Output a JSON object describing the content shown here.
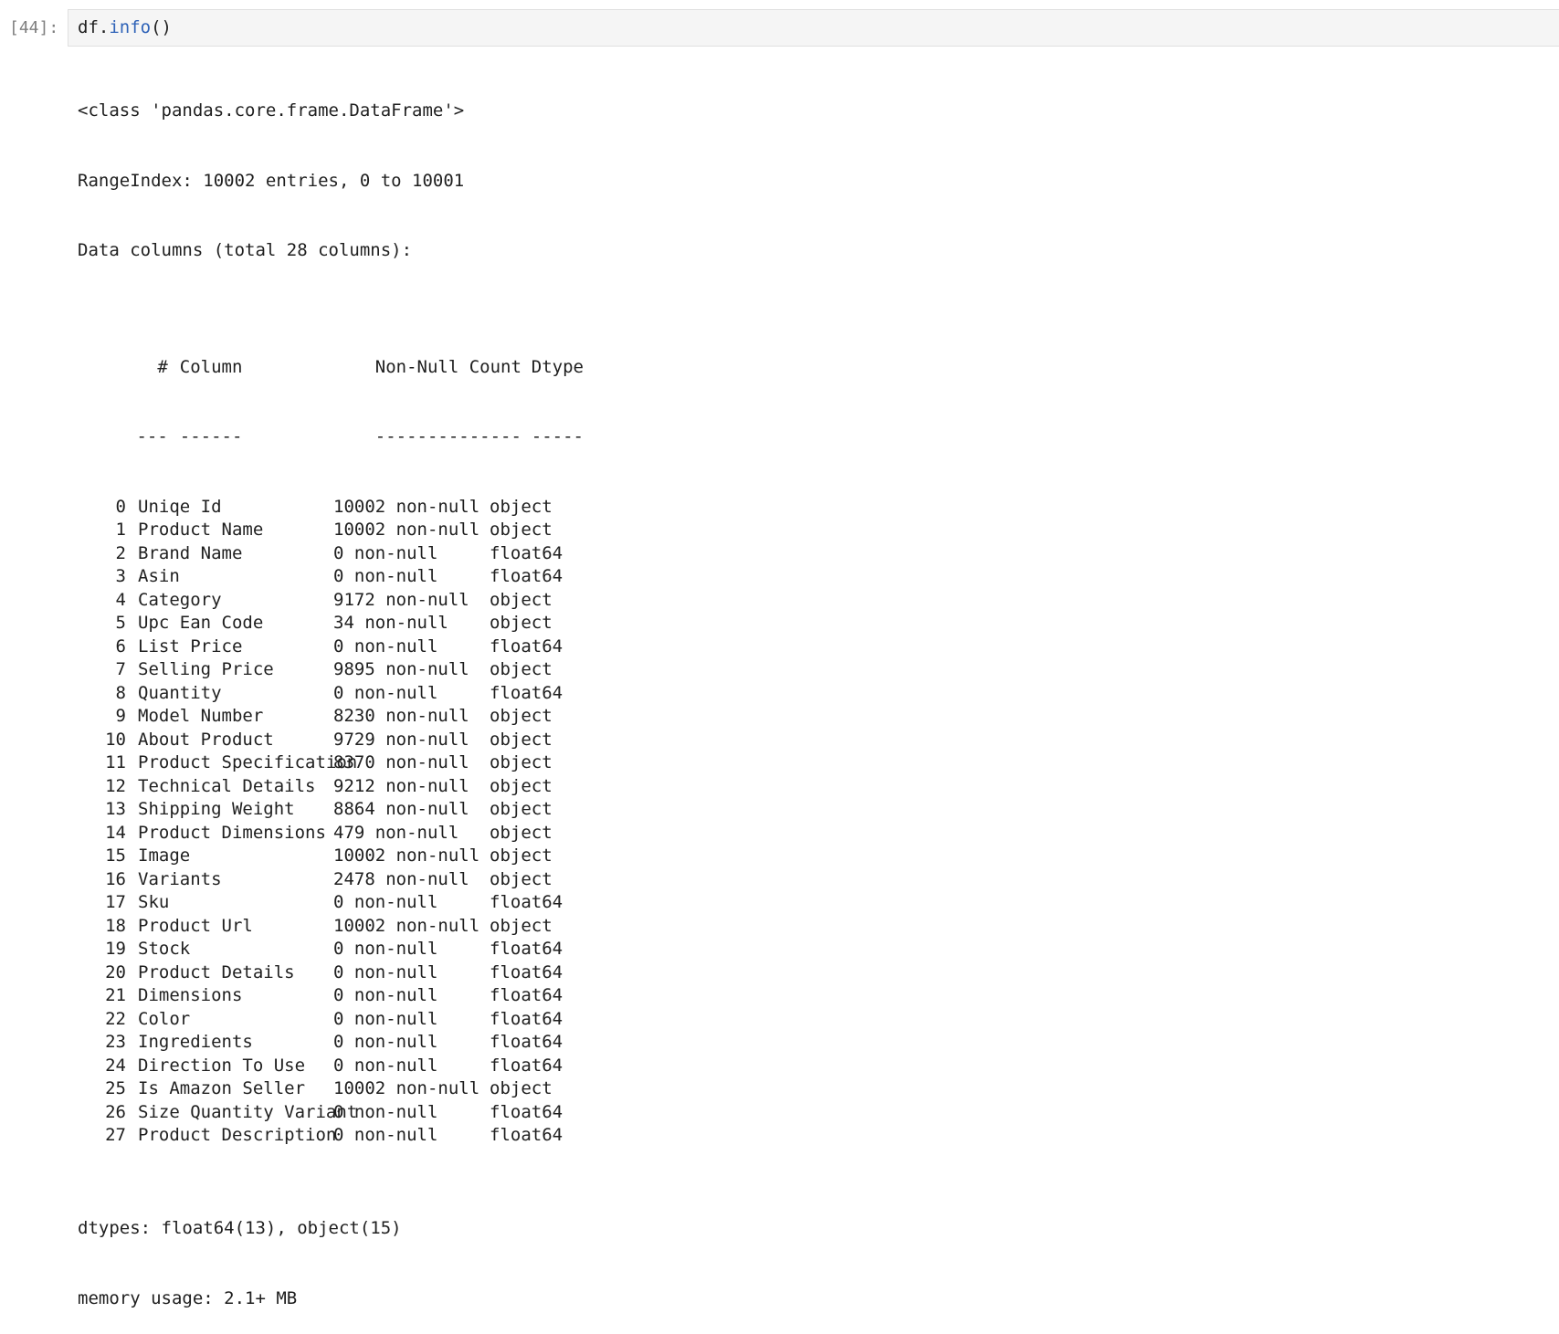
{
  "cell": {
    "prompt": "[44]:",
    "code_object": "df",
    "code_dot": ".",
    "code_function": "info",
    "code_parens": "()"
  },
  "output": {
    "class_line": "<class 'pandas.core.frame.DataFrame'>",
    "range_index": "RangeIndex: 10002 entries, 0 to 10001",
    "data_columns": "Data columns (total 28 columns):",
    "headers": [
      "#",
      "Column",
      "Non-Null Count",
      "Dtype"
    ],
    "separators": [
      "---",
      "------",
      "--------------",
      "-----"
    ],
    "rows": [
      {
        "idx": "0",
        "name": "Uniqe Id",
        "count": "10002 non-null",
        "dtype": "object"
      },
      {
        "idx": "1",
        "name": "Product Name",
        "count": "10002 non-null",
        "dtype": "object"
      },
      {
        "idx": "2",
        "name": "Brand Name",
        "count": "0 non-null",
        "dtype": "float64"
      },
      {
        "idx": "3",
        "name": "Asin",
        "count": "0 non-null",
        "dtype": "float64"
      },
      {
        "idx": "4",
        "name": "Category",
        "count": "9172 non-null",
        "dtype": "object"
      },
      {
        "idx": "5",
        "name": "Upc Ean Code",
        "count": "34 non-null",
        "dtype": "object"
      },
      {
        "idx": "6",
        "name": "List Price",
        "count": "0 non-null",
        "dtype": "float64"
      },
      {
        "idx": "7",
        "name": "Selling Price",
        "count": "9895 non-null",
        "dtype": "object"
      },
      {
        "idx": "8",
        "name": "Quantity",
        "count": "0 non-null",
        "dtype": "float64"
      },
      {
        "idx": "9",
        "name": "Model Number",
        "count": "8230 non-null",
        "dtype": "object"
      },
      {
        "idx": "10",
        "name": "About Product",
        "count": "9729 non-null",
        "dtype": "object"
      },
      {
        "idx": "11",
        "name": "Product Specification",
        "count": "8370 non-null",
        "dtype": "object"
      },
      {
        "idx": "12",
        "name": "Technical Details",
        "count": "9212 non-null",
        "dtype": "object"
      },
      {
        "idx": "13",
        "name": "Shipping Weight",
        "count": "8864 non-null",
        "dtype": "object"
      },
      {
        "idx": "14",
        "name": "Product Dimensions",
        "count": "479 non-null",
        "dtype": "object"
      },
      {
        "idx": "15",
        "name": "Image",
        "count": "10002 non-null",
        "dtype": "object"
      },
      {
        "idx": "16",
        "name": "Variants",
        "count": "2478 non-null",
        "dtype": "object"
      },
      {
        "idx": "17",
        "name": "Sku",
        "count": "0 non-null",
        "dtype": "float64"
      },
      {
        "idx": "18",
        "name": "Product Url",
        "count": "10002 non-null",
        "dtype": "object"
      },
      {
        "idx": "19",
        "name": "Stock",
        "count": "0 non-null",
        "dtype": "float64"
      },
      {
        "idx": "20",
        "name": "Product Details",
        "count": "0 non-null",
        "dtype": "float64"
      },
      {
        "idx": "21",
        "name": "Dimensions",
        "count": "0 non-null",
        "dtype": "float64"
      },
      {
        "idx": "22",
        "name": "Color",
        "count": "0 non-null",
        "dtype": "float64"
      },
      {
        "idx": "23",
        "name": "Ingredients",
        "count": "0 non-null",
        "dtype": "float64"
      },
      {
        "idx": "24",
        "name": "Direction To Use",
        "count": "0 non-null",
        "dtype": "float64"
      },
      {
        "idx": "25",
        "name": "Is Amazon Seller",
        "count": "10002 non-null",
        "dtype": "object"
      },
      {
        "idx": "26",
        "name": "Size Quantity Variant",
        "count": "0 non-null",
        "dtype": "float64"
      },
      {
        "idx": "27",
        "name": "Product Description",
        "count": "0 non-null",
        "dtype": "float64"
      }
    ],
    "dtypes_line": "dtypes: float64(13), object(15)",
    "memory_line": "memory usage: 2.1+ MB"
  }
}
